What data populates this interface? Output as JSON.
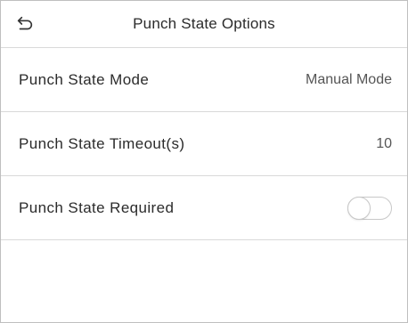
{
  "header": {
    "title": "Punch State Options",
    "back_icon": "back-arrow-icon"
  },
  "rows": [
    {
      "label": "Punch State Mode",
      "value": "Manual Mode"
    },
    {
      "label": "Punch State Timeout(s)",
      "value": "10"
    },
    {
      "label": "Punch State Required",
      "toggle_on": false
    }
  ],
  "colors": {
    "divider": "#d9d9d9",
    "text": "#2b2b2b",
    "toggle_border": "#c8c8c8"
  }
}
